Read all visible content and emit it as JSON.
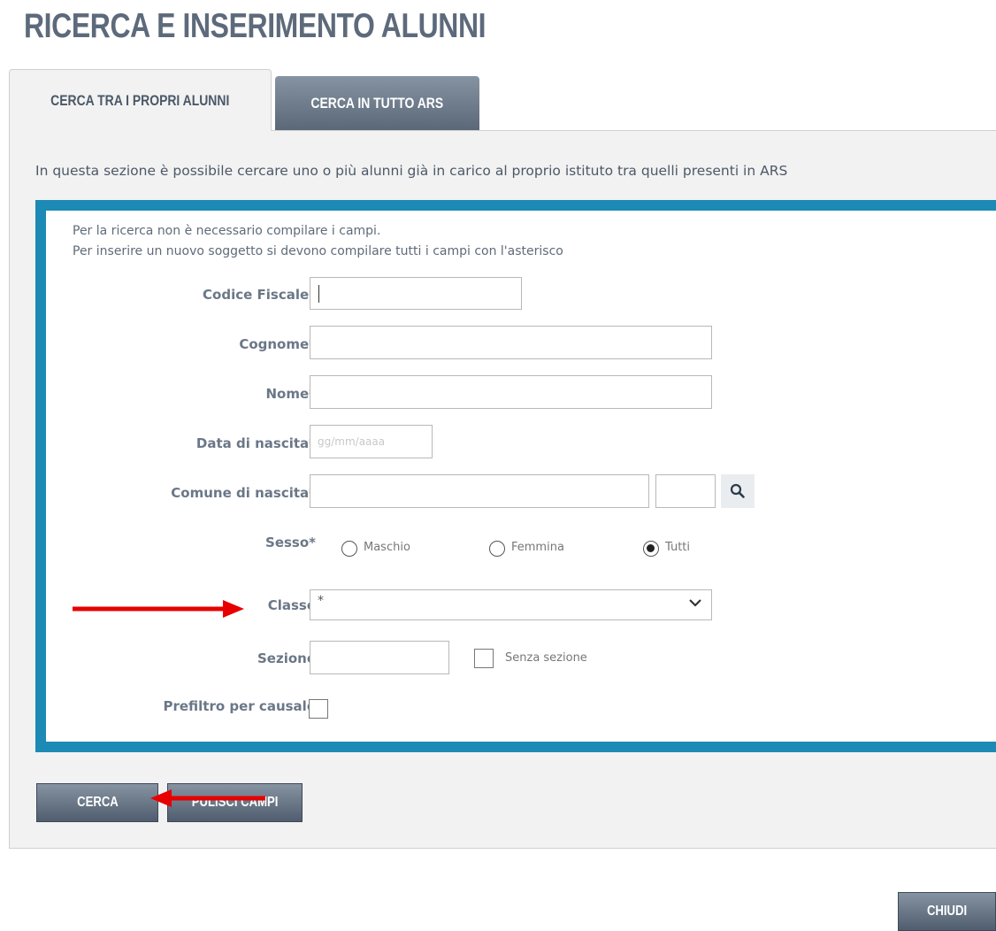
{
  "page": {
    "title": "RICERCA E INSERIMENTO ALUNNI"
  },
  "tabs": [
    {
      "label": "CERCA TRA I PROPRI ALUNNI",
      "active": true
    },
    {
      "label": "CERCA IN TUTTO ARS",
      "active": false
    }
  ],
  "description": "In questa sezione è possibile cercare uno o più alunni già in carico al proprio istituto tra quelli presenti in ARS",
  "form": {
    "note_line1": "Per la ricerca non è necessario compilare i campi.",
    "note_line2": "Per inserire un nuovo soggetto si devono compilare tutti i campi con l'asterisco",
    "codice_fiscale": {
      "label": "Codice Fiscale*",
      "value": ""
    },
    "cognome": {
      "label": "Cognome*",
      "value": ""
    },
    "nome": {
      "label": "Nome*",
      "value": ""
    },
    "data_nascita": {
      "label": "Data di nascita*",
      "placeholder": "gg/mm/aaaa"
    },
    "comune_nascita": {
      "label": "Comune di nascita*",
      "value": "",
      "provincia": ""
    },
    "sesso": {
      "label": "Sesso*",
      "options": [
        {
          "label": "Maschio",
          "selected": false
        },
        {
          "label": "Femmina",
          "selected": false
        },
        {
          "label": "Tutti",
          "selected": true
        }
      ]
    },
    "classe": {
      "label": "Classe",
      "selected": "*"
    },
    "sezione": {
      "label": "Sezione",
      "value": "",
      "senza_sezione_label": "Senza sezione",
      "senza_sezione_checked": false
    },
    "prefiltro": {
      "label": "Prefiltro per causale",
      "checked": false
    }
  },
  "buttons": {
    "cerca": "CERCA",
    "pulisci": "PULISCI CAMPI",
    "chiudi": "CHIUDI"
  },
  "colors": {
    "accent_border": "#1c8ab4",
    "annotation_arrow": "#e60000",
    "button_dark": "#5a6777"
  },
  "icons": {
    "search": "search-icon",
    "chevron": "chevron-down-icon"
  }
}
